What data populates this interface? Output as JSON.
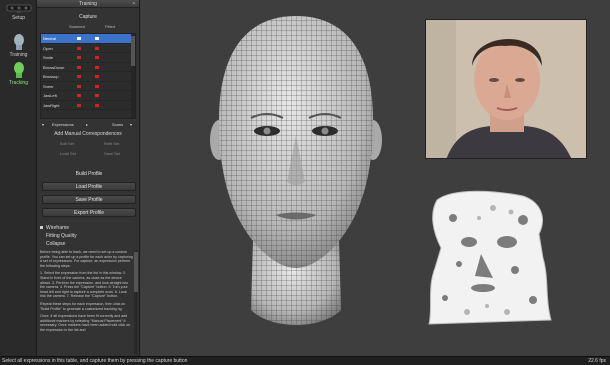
{
  "modes": [
    {
      "label": "Setup",
      "icon": "camera-icon"
    },
    {
      "label": "Training",
      "icon": "head-icon"
    },
    {
      "label": "Tracking",
      "icon": "head-icon"
    }
  ],
  "panel": {
    "title": "Training",
    "capture_header": "Capture",
    "col_scanned": "Scanned",
    "col_fitted": "Fitted",
    "expressions": [
      "Neutral",
      "Open",
      "Smile",
      "BrowsDown",
      "Browsup",
      "Sneer",
      "JawLeft",
      "JawRight"
    ],
    "selected_expression": "Neutral",
    "filter_expressions": "Expressions",
    "filter_scans": "Scans",
    "manual_header": "Add Manual Correspondences",
    "mini_edit_set": "Edit Set",
    "mini_refit_set": "Refit Set",
    "mini_load_set": "Load Set",
    "mini_save_set": "Save Set",
    "build_profile": "Build Profile",
    "load_profile": "Load Profile",
    "save_profile": "Save Profile",
    "export_profile": "Export Profile",
    "opt_wireframe": "Wireframe",
    "opt_fitting_quality": "Fitting Quality",
    "opt_collapse": "Collapse",
    "help_1": "Before being able to track, we need to set up a custom profile. You can set up a profile for each actor by capturing a set of expressions. For capture, an expression perform the following steps:",
    "help_2": "1. Select the expression from the list in this window. 2. Stand in front of the camera, as close as the device allows. 3. Perform the expression, and look straight into the camera. 4. Press the \"Capture\" button. 5. Turn your head left and right to capture a complete scan. 6. Look into the camera. 7. Release the \"Capture\" button.",
    "help_3": "Repeat these steps for each expression, then click on \"Build Profile\" to generate a customized tracking rig.",
    "help_4": "Once, if all expressions have been fit correctly and add additional markers by selecting \"Manual Placement\" if necessary. Once markers have been added hold click on the expression in the list and"
  },
  "status": {
    "message": "Select all expressions in this table, and capture them by pressing the capture button",
    "fps": "22.6 fps"
  },
  "colors": {
    "accent": "#3a73c9",
    "marker": "#d02424",
    "tracking": "#8fe07a"
  }
}
